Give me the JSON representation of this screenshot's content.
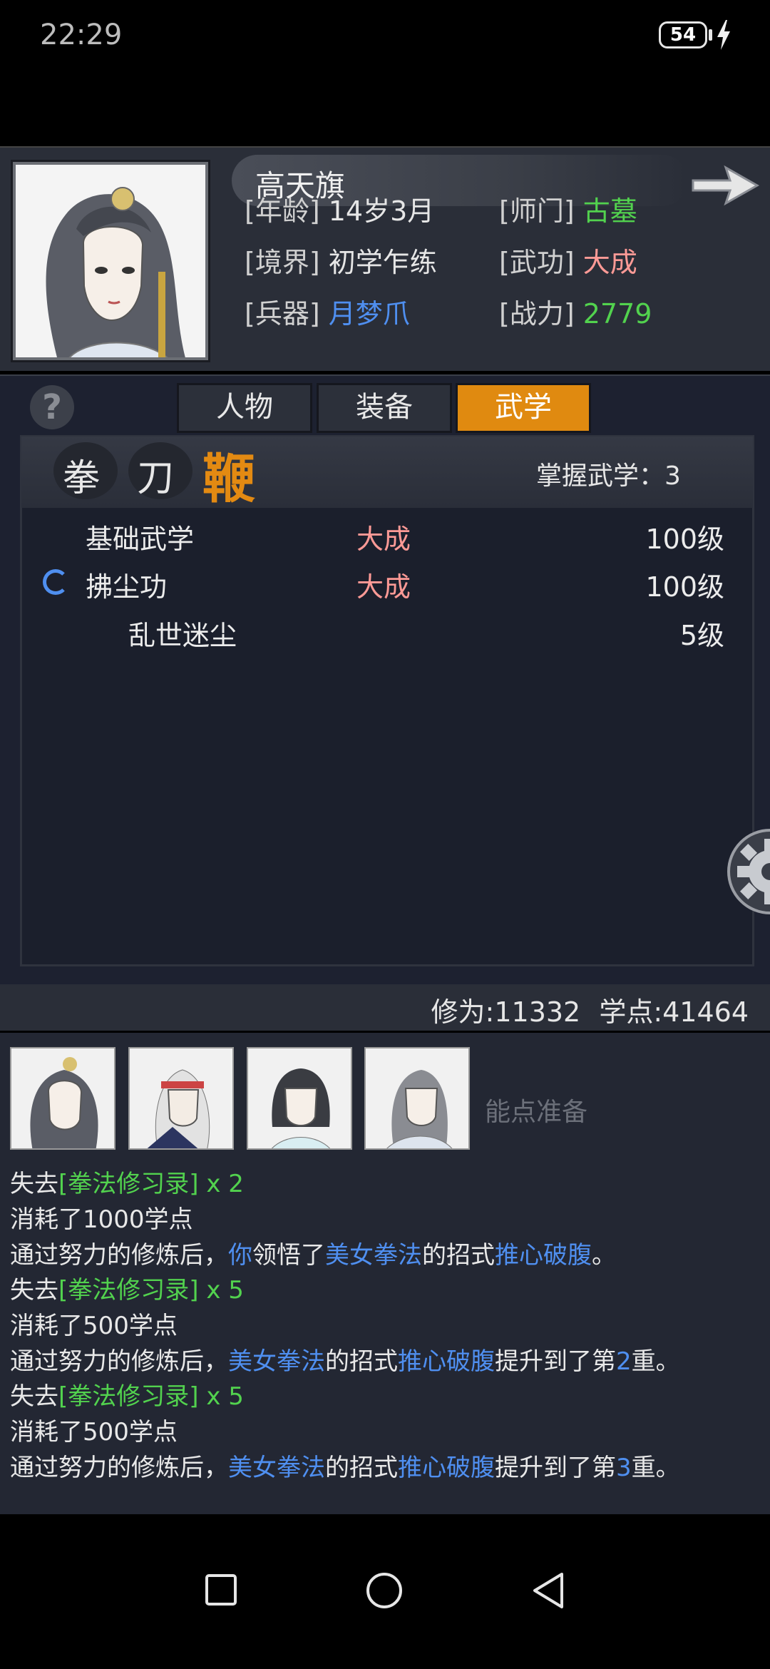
{
  "status_bar": {
    "time": "22:29",
    "battery": "54"
  },
  "character": {
    "name": "高天旗",
    "fields": [
      {
        "label": "[年龄]",
        "value": "14岁3月",
        "color": "default"
      },
      {
        "label": "[师门]",
        "value": "古墓",
        "color": "green"
      },
      {
        "label": "[境界]",
        "value": "初学乍练",
        "color": "default"
      },
      {
        "label": "[武功]",
        "value": "大成",
        "color": "pink"
      },
      {
        "label": "[兵器]",
        "value": "月梦爪",
        "color": "blue"
      },
      {
        "label": "[战力]",
        "value": "2779",
        "color": "green"
      }
    ]
  },
  "help_label": "?",
  "tabs": [
    {
      "label": "人物",
      "active": false
    },
    {
      "label": "装备",
      "active": false
    },
    {
      "label": "武学",
      "active": true
    }
  ],
  "categories": [
    {
      "label": "拳",
      "active": false
    },
    {
      "label": "刀",
      "active": false
    },
    {
      "label": "鞭",
      "active": true
    }
  ],
  "mastery_text": "掌握武学：3",
  "skills": [
    {
      "name": "基础武学",
      "grade": "大成",
      "level": "100级"
    },
    {
      "name": "拂尘功",
      "grade": "大成",
      "level": "100级"
    },
    {
      "name": "乱世迷尘",
      "grade": "",
      "level": "5级"
    }
  ],
  "stats": {
    "cultivation": "修为:11332",
    "points": "学点:41464"
  },
  "log": {
    "ghost_text": "能点准备",
    "lines": [
      [
        {
          "t": "失去",
          "c": "w"
        },
        {
          "t": "[拳法修习录]",
          "c": "g"
        },
        {
          "t": " x 2",
          "c": "g"
        }
      ],
      [
        {
          "t": "消耗了1000学点",
          "c": "w"
        }
      ],
      [
        {
          "t": "通过努力的修炼后，",
          "c": "w"
        },
        {
          "t": "你",
          "c": "b"
        },
        {
          "t": "领悟了",
          "c": "w"
        },
        {
          "t": "美女拳法",
          "c": "b"
        },
        {
          "t": "的招式",
          "c": "w"
        },
        {
          "t": "推心破腹",
          "c": "b"
        },
        {
          "t": "。",
          "c": "w"
        }
      ],
      [
        {
          "t": "失去",
          "c": "w"
        },
        {
          "t": "[拳法修习录]",
          "c": "g"
        },
        {
          "t": " x 5",
          "c": "g"
        }
      ],
      [
        {
          "t": "消耗了500学点",
          "c": "w"
        }
      ],
      [
        {
          "t": "通过努力的修炼后，",
          "c": "w"
        },
        {
          "t": "美女拳法",
          "c": "b"
        },
        {
          "t": "的招式",
          "c": "w"
        },
        {
          "t": "推心破腹",
          "c": "b"
        },
        {
          "t": "提升到了第",
          "c": "w"
        },
        {
          "t": "2",
          "c": "b"
        },
        {
          "t": "重。",
          "c": "w"
        }
      ],
      [
        {
          "t": "失去",
          "c": "w"
        },
        {
          "t": "[拳法修习录]",
          "c": "g"
        },
        {
          "t": " x 5",
          "c": "g"
        }
      ],
      [
        {
          "t": "消耗了500学点",
          "c": "w"
        }
      ],
      [
        {
          "t": "通过努力的修炼后，",
          "c": "w"
        },
        {
          "t": "美女拳法",
          "c": "b"
        },
        {
          "t": "的招式",
          "c": "w"
        },
        {
          "t": "推心破腹",
          "c": "b"
        },
        {
          "t": "提升到了第",
          "c": "w"
        },
        {
          "t": "3",
          "c": "b"
        },
        {
          "t": "重。",
          "c": "w"
        }
      ]
    ]
  },
  "icons": [
    "battery-icon",
    "charging-bolt-icon",
    "next-arrow-icon",
    "help-icon",
    "loading-spinner-icon",
    "settings-gear-icon",
    "recent-apps-icon",
    "home-icon",
    "back-icon"
  ]
}
